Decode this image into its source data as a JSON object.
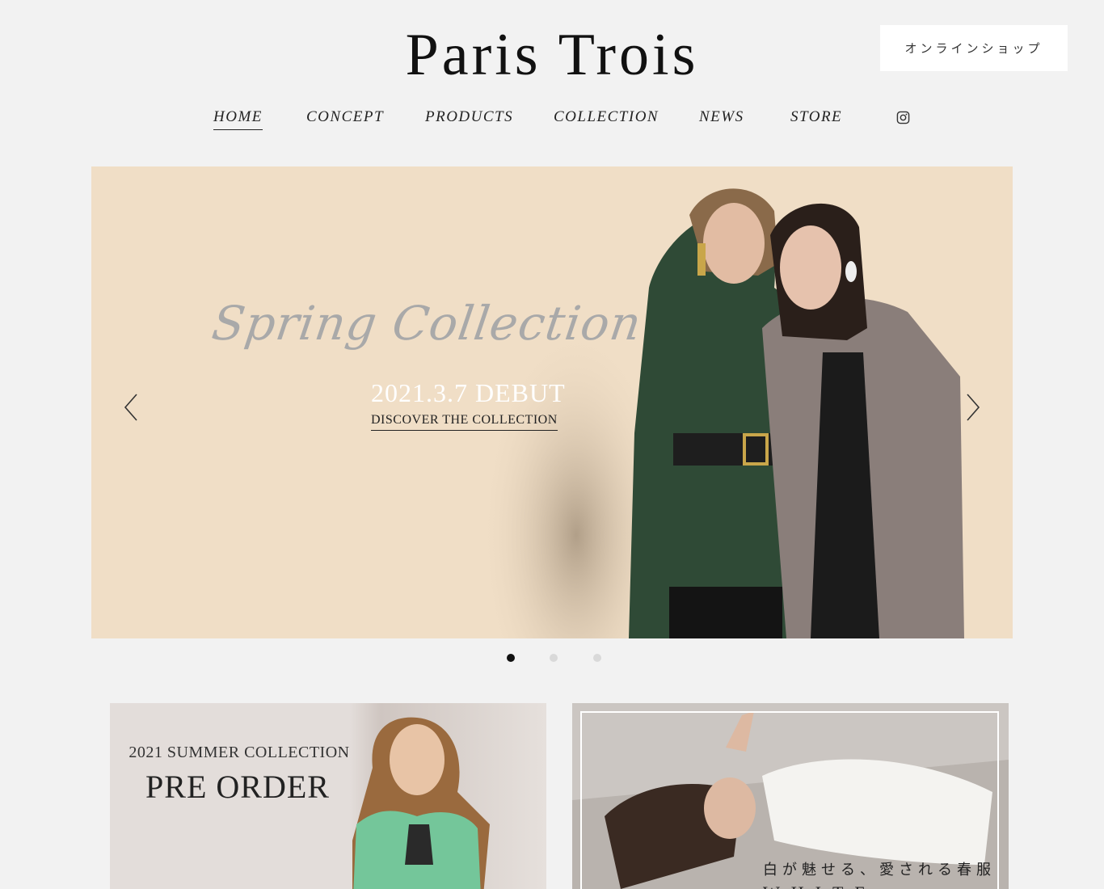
{
  "header": {
    "logo": "Paris Trois",
    "shop_button": "オンラインショップ"
  },
  "nav": {
    "items": [
      {
        "label": "HOME",
        "active": true
      },
      {
        "label": "CONCEPT",
        "active": false
      },
      {
        "label": "PRODUCTS",
        "active": false
      },
      {
        "label": "COLLECTION",
        "active": false
      },
      {
        "label": "NEWS",
        "active": false
      },
      {
        "label": "STORE",
        "active": false
      }
    ],
    "social_icon": "instagram-icon"
  },
  "hero": {
    "script_title": "Spring Collection",
    "debut": "2021.3.7 DEBUT",
    "cta": "DISCOVER THE COLLECTION",
    "background_color": "#f0dec6",
    "prev_icon": "chevron-left-icon",
    "next_icon": "chevron-right-icon"
  },
  "carousel": {
    "slide_count": 3,
    "active_index": 0
  },
  "cards": [
    {
      "subtitle": "2021 SUMMER COLLECTION",
      "title": "PRE ORDER"
    },
    {
      "subtitle": "白が魅せる、愛される春服",
      "title": "WHITE BEAUTY"
    }
  ]
}
